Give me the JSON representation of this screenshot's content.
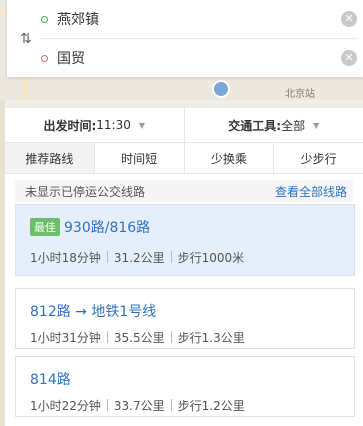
{
  "map": {
    "label": "北京站"
  },
  "search": {
    "from": "燕郊镇",
    "to": "国贸"
  },
  "options": {
    "depart_label": "出发时间:",
    "depart_value": "11:30",
    "transport_label": "交通工具:",
    "transport_value": "全部"
  },
  "tabs": [
    "推荐路线",
    "时间短",
    "少换乘",
    "少步行"
  ],
  "notice": {
    "text": "未显示已停运公交线路",
    "link": "查看全部线路"
  },
  "routes": [
    {
      "badge": "最佳",
      "name": "930路/816路",
      "duration": "1小时18分钟",
      "distance": "31.2公里",
      "walk": "步行1000米"
    },
    {
      "badge": "",
      "name": "812路 → 地铁1号线",
      "duration": "1小时31分钟",
      "distance": "35.5公里",
      "walk": "步行1.3公里"
    },
    {
      "badge": "",
      "name": "814路",
      "duration": "1小时22分钟",
      "distance": "33.7公里",
      "walk": "步行1.2公里"
    }
  ],
  "colors": {
    "accent": "#2d73c2",
    "badge": "#6cbf6a",
    "best_bg": "#e7eefb"
  }
}
